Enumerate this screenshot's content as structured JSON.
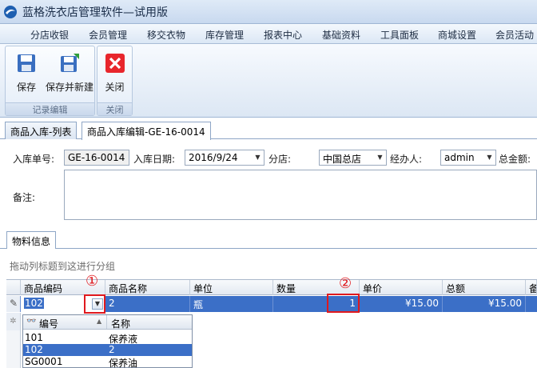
{
  "app": {
    "title": "蓝格洗衣店管理软件—试用版"
  },
  "menu": [
    "分店收银",
    "会员管理",
    "移交衣物",
    "库存管理",
    "报表中心",
    "基础资料",
    "工具面板",
    "商城设置",
    "会员活动"
  ],
  "ribbon": {
    "groups": [
      {
        "label": "记录编辑"
      },
      {
        "label": "关闭"
      }
    ],
    "buttons": {
      "save": "保存",
      "save_new": "保存并新建",
      "close": "关闭"
    }
  },
  "tabs": [
    "商品入库-列表",
    "商品入库编辑-GE-16-0014"
  ],
  "form": {
    "order_no_label": "入库单号:",
    "order_no": "GE-16-0014",
    "date_label": "入库日期:",
    "date": "2016/9/24",
    "store_label": "分店:",
    "store": "中国总店",
    "handler_label": "经办人:",
    "handler": "admin",
    "total_label": "总金额:",
    "remark_label": "备注:"
  },
  "inner_tab": "物料信息",
  "grid": {
    "group_hint": "拖动列标题到这进行分组",
    "columns": [
      "商品编码",
      "商品名称",
      "单位",
      "数量",
      "单价",
      "总额",
      "备"
    ],
    "row": {
      "code": "102",
      "name": "2",
      "unit": "瓶",
      "qty": "1",
      "price": "¥15.00",
      "total": "¥15.00"
    }
  },
  "popup": {
    "columns": [
      "编号",
      "名称"
    ],
    "rows": [
      {
        "code": "101",
        "name": "保养液"
      },
      {
        "code": "102",
        "name": "2"
      },
      {
        "code": "SG0001",
        "name": "保养油"
      }
    ]
  },
  "annotations": {
    "m1": "①",
    "m2": "②"
  },
  "colors": {
    "selection": "#3b6fc7",
    "annotation": "#e0191e",
    "close_button": "#e8262c"
  }
}
